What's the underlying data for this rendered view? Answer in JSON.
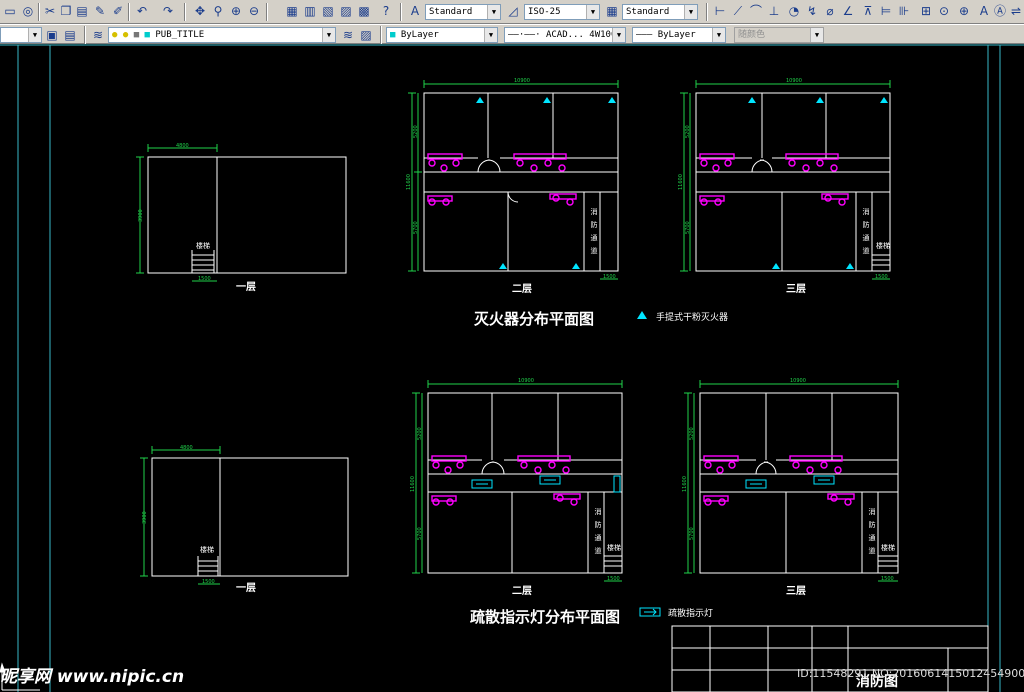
{
  "toolbar1": {
    "text_style": "Standard",
    "dim_style": "ISO-25",
    "table_style": "Standard"
  },
  "toolbar2": {
    "layer_name": "PUB_TITLE",
    "color": "ByLayer",
    "linetype": "ACAD... 4W100",
    "lineweight": "ByLayer",
    "plot_style": "随颜色"
  },
  "drawing": {
    "panels": {
      "top_floor1": {
        "dim_w": "4800",
        "dim_h": "3900",
        "dim_stair": "1500",
        "stair_label": "楼梯",
        "floor_label": "一层"
      },
      "top_floor2": {
        "dim_w": "10900",
        "dim_h": "11600",
        "dim_a": "5200",
        "dim_b": "5700",
        "dim_c": "1500",
        "corridor_label": "消防通道",
        "floor_label": "二层"
      },
      "top_floor3": {
        "dim_w": "10900",
        "dim_h": "11600",
        "dim_a": "5200",
        "dim_b": "5700",
        "dim_c": "1500",
        "corridor_label": "消防通道",
        "stair_label": "楼梯",
        "floor_label": "三层"
      },
      "bottom_floor1": {
        "dim_w": "4800",
        "dim_h": "3900",
        "dim_stair": "1500",
        "stair_label": "楼梯",
        "floor_label": "一层"
      },
      "bottom_floor2": {
        "dim_w": "10900",
        "dim_h": "11600",
        "dim_a": "5200",
        "dim_b": "5700",
        "dim_c": "1500",
        "corridor_label": "消防通道",
        "stair_label": "楼梯",
        "floor_label": "二层"
      },
      "bottom_floor3": {
        "dim_w": "10900",
        "dim_h": "11600",
        "dim_a": "5200",
        "dim_b": "5700",
        "dim_c": "1500",
        "corridor_label": "消防通道",
        "stair_label": "楼梯",
        "floor_label": "三层"
      }
    },
    "section1": {
      "title": "灭火器分布平面图",
      "legend": "手提式干粉灭火器"
    },
    "section2": {
      "title": "疏散指示灯分布平面图",
      "legend": "疏散指示灯"
    },
    "title_block": {
      "name": "消防图"
    }
  },
  "watermark": {
    "site": "昵享网 www.nipic.cn",
    "id": "ID:11548291 NO:20160614150124549000"
  },
  "colors": {
    "background": "#000000",
    "line_white": "#ffffff",
    "dimension_green": "#1fd24a",
    "fixture_magenta": "#ff00ff",
    "symbol_cyan": "#00e5ff",
    "frame_cyan": "#39b9c8",
    "toolbar_gray": "#d4d0c8"
  },
  "icons": {
    "toolbar1": [
      "new-file-icon",
      "globe-icon",
      "cut-icon",
      "copy-icon",
      "paste-icon",
      "brush-icon",
      "match-prop-icon",
      "undo-icon",
      "redo-icon",
      "pan-icon",
      "zoom-realtime-icon",
      "zoom-window-icon",
      "zoom-previous-icon",
      "properties-icon",
      "design-center-icon",
      "tool-palette-icon",
      "sheet-set-icon",
      "markup-icon",
      "calculator-icon",
      "help-icon",
      "text-style-icon",
      "dim-style-icon",
      "table-style-icon",
      "linear-dim-icon",
      "aligned-dim-icon",
      "arc-length-icon",
      "ordinate-dim-icon",
      "radius-dim-icon",
      "jogged-dim-icon",
      "diameter-dim-icon",
      "angular-dim-icon",
      "quick-dim-icon",
      "baseline-dim-icon",
      "continue-dim-icon",
      "tolerance-icon",
      "center-mark-icon",
      "dim-edit-icon",
      "dim-text-edit-icon",
      "dim-update-icon"
    ],
    "toolbar2": [
      "layer-manager-icon",
      "layer-state-icon",
      "layer-previous-icon",
      "layer-make-current-icon"
    ]
  }
}
